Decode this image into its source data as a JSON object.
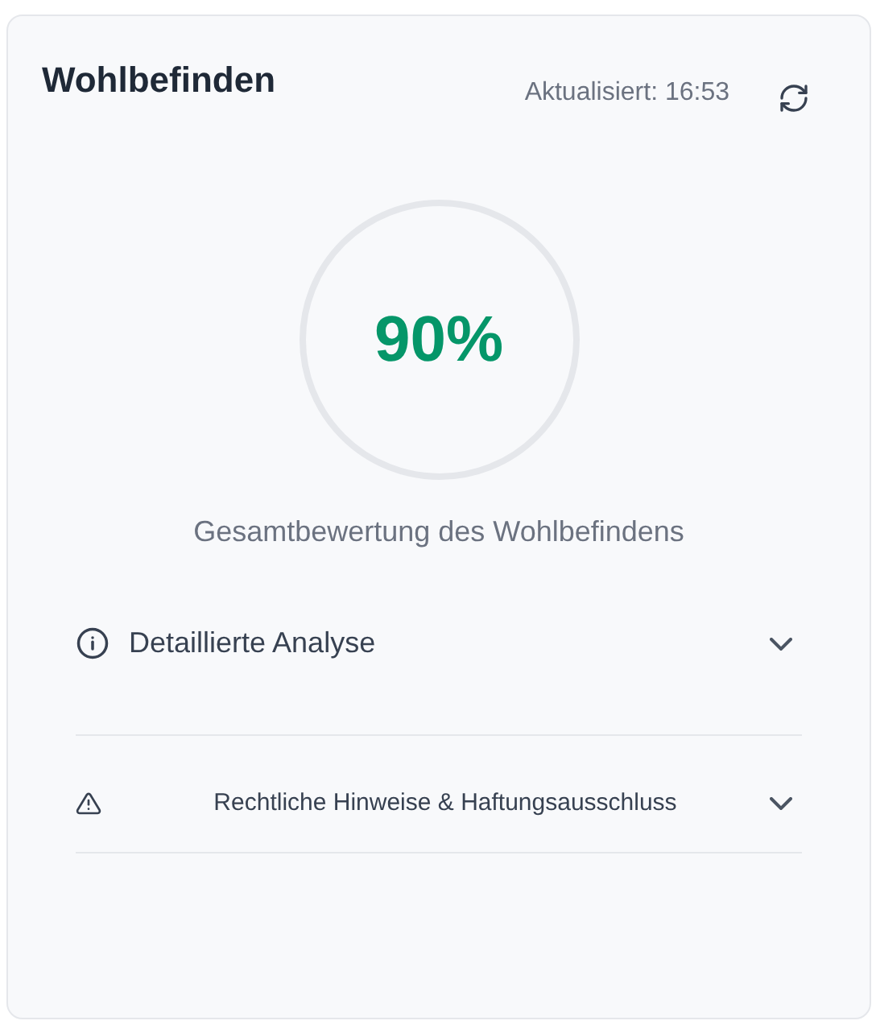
{
  "title": "Wohlbefinden",
  "updated": "Aktualisiert: 16:53",
  "score": {
    "value": "90%",
    "caption": "Gesamtbewertung des Wohlbefindens"
  },
  "sections": [
    {
      "kind": "info",
      "label": "Detaillierte Analyse",
      "expanded": false
    },
    {
      "kind": "warning",
      "label": "Rechtliche Hinweise & Haftungsausschluss",
      "expanded": false
    }
  ]
}
